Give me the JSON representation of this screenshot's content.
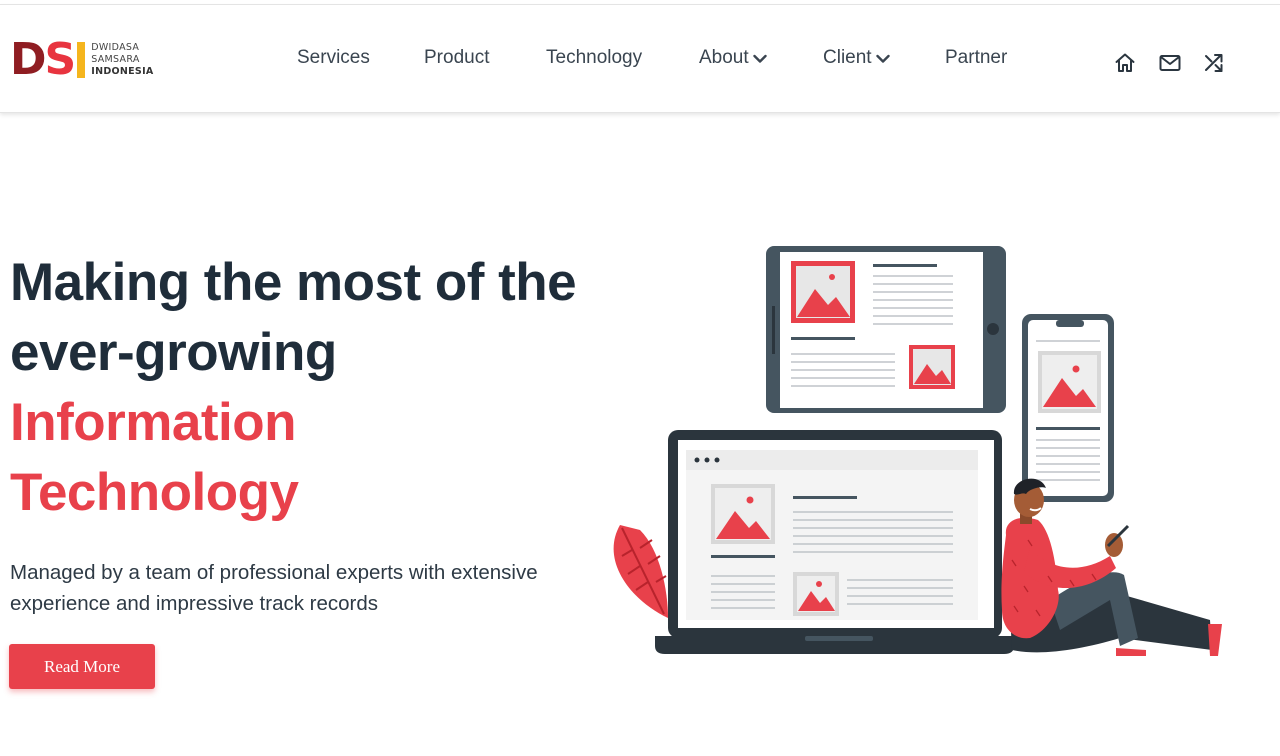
{
  "brand": {
    "mark_d": "D",
    "mark_s": "S",
    "line1": "DWIDASA",
    "line2": "SAMSARA",
    "line3": "INDONESIA",
    "colors": {
      "dark_red": "#8f1d22",
      "red": "#e8343f",
      "yellow": "#f5b51d"
    }
  },
  "nav": {
    "items": [
      {
        "label": "Services",
        "dropdown": false
      },
      {
        "label": "Product",
        "dropdown": false
      },
      {
        "label": "Technology",
        "dropdown": false
      },
      {
        "label": "About",
        "dropdown": true
      },
      {
        "label": "Client",
        "dropdown": true
      },
      {
        "label": "Partner",
        "dropdown": false
      }
    ]
  },
  "header_icons": [
    "home-icon",
    "mail-icon",
    "shuffle-icon"
  ],
  "hero": {
    "title_line1": "Making the most of the",
    "title_line2": "ever-growing",
    "title_line3": "Information",
    "title_line4": "Technology",
    "subtitle": "Managed by a team of professional experts with extensive experience and impressive track records",
    "button_label": "Read More"
  },
  "theme": {
    "accent": "#e8414b",
    "text_dark": "#1f2d3a",
    "device_frame": "#455560"
  }
}
